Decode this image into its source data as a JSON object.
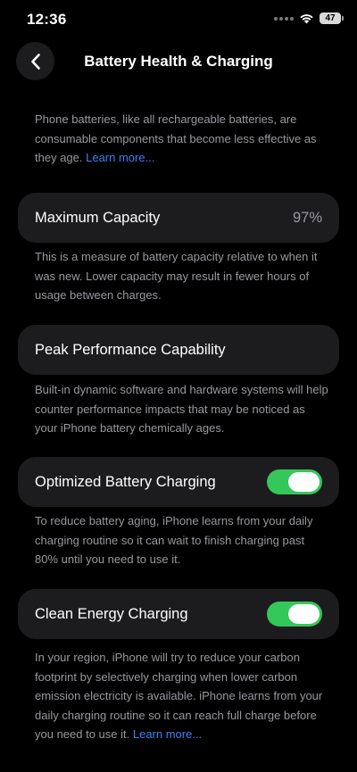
{
  "status_bar": {
    "time": "12:36",
    "battery_level": "47"
  },
  "nav": {
    "title": "Battery Health & Charging",
    "back_icon": "chevron-left-icon"
  },
  "intro": {
    "text": "Phone batteries, like all rechargeable batteries, are consumable components that become less effective as they age. ",
    "link": "Learn more..."
  },
  "maximum_capacity": {
    "label": "Maximum Capacity",
    "value": "97%",
    "description": "This is a measure of battery capacity relative to when it was new. Lower capacity may result in fewer hours of usage between charges."
  },
  "peak_performance": {
    "label": "Peak Performance Capability",
    "description": "Built-in dynamic software and hardware systems will help counter performance impacts that may be noticed as your iPhone battery chemically ages."
  },
  "optimized_charging": {
    "label": "Optimized Battery Charging",
    "enabled": true,
    "description": "To reduce battery aging, iPhone learns from your daily charging routine so it can wait to finish charging past 80% until you need to use it."
  },
  "clean_energy": {
    "label": "Clean Energy Charging",
    "enabled": true,
    "description": "In your region, iPhone will try to reduce your carbon footprint by selectively charging when lower carbon emission electricity is available. iPhone learns from your daily charging routine so it can reach full charge before you need to use it. ",
    "link": "Learn more..."
  },
  "colors": {
    "background": "#000000",
    "card": "#1c1c1e",
    "toggle_on": "#34c759",
    "link": "#3b82f6",
    "secondary_text": "#98989f"
  }
}
